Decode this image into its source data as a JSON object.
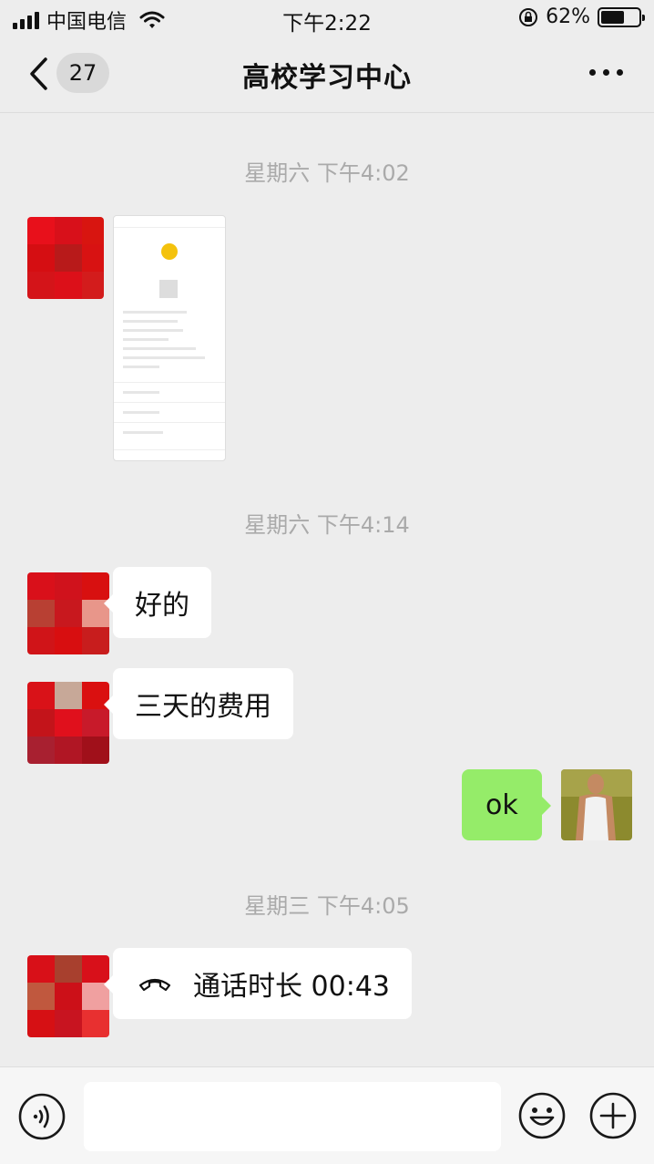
{
  "status_bar": {
    "carrier": "中国电信",
    "time": "下午2:22",
    "battery": "62%",
    "battery_level": 0.62
  },
  "nav": {
    "back_badge": "27",
    "title": "高校学习中心"
  },
  "messages": [
    {
      "type": "timestamp",
      "text": "星期六 下午4:02"
    },
    {
      "type": "image",
      "side": "left"
    },
    {
      "type": "timestamp",
      "text": "星期六 下午4:14"
    },
    {
      "type": "text",
      "side": "left",
      "text": "好的"
    },
    {
      "type": "text",
      "side": "left",
      "text": "三天的费用"
    },
    {
      "type": "text",
      "side": "right",
      "text": "ok"
    },
    {
      "type": "timestamp",
      "text": "星期三 下午4:05"
    },
    {
      "type": "call",
      "side": "left",
      "text": "通话时长 00:43"
    }
  ],
  "colors": {
    "chat_background": "#ededed",
    "sent_bubble": "#95ec69",
    "received_bubble": "#ffffff",
    "timestamp_text": "#aaaaaa"
  },
  "icons": [
    "back-icon",
    "more-icon",
    "call-icon",
    "voice-icon",
    "emoji-icon",
    "plus-icon",
    "wifi-icon",
    "signal-icon",
    "battery-icon"
  ]
}
